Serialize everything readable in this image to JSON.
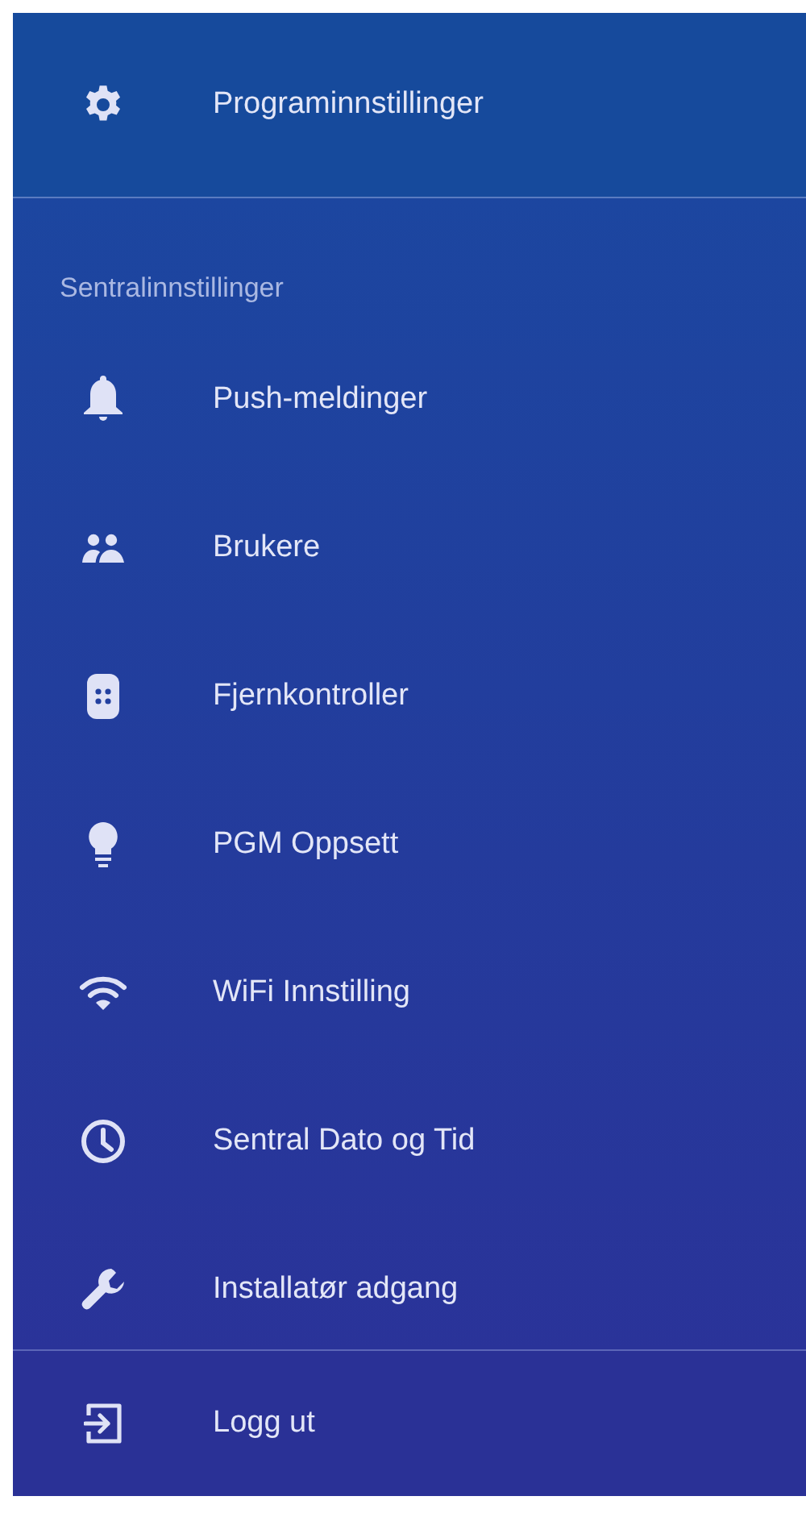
{
  "top_item": {
    "label": "Programinnstillinger"
  },
  "section": {
    "title": "Sentralinnstillinger",
    "items": [
      {
        "label": "Push-meldinger"
      },
      {
        "label": "Brukere"
      },
      {
        "label": "Fjernkontroller"
      },
      {
        "label": "PGM Oppsett"
      },
      {
        "label": "WiFi Innstilling"
      },
      {
        "label": "Sentral Dato og Tid"
      },
      {
        "label": "Installatør adgang"
      }
    ]
  },
  "footer": {
    "label": "Logg ut"
  }
}
